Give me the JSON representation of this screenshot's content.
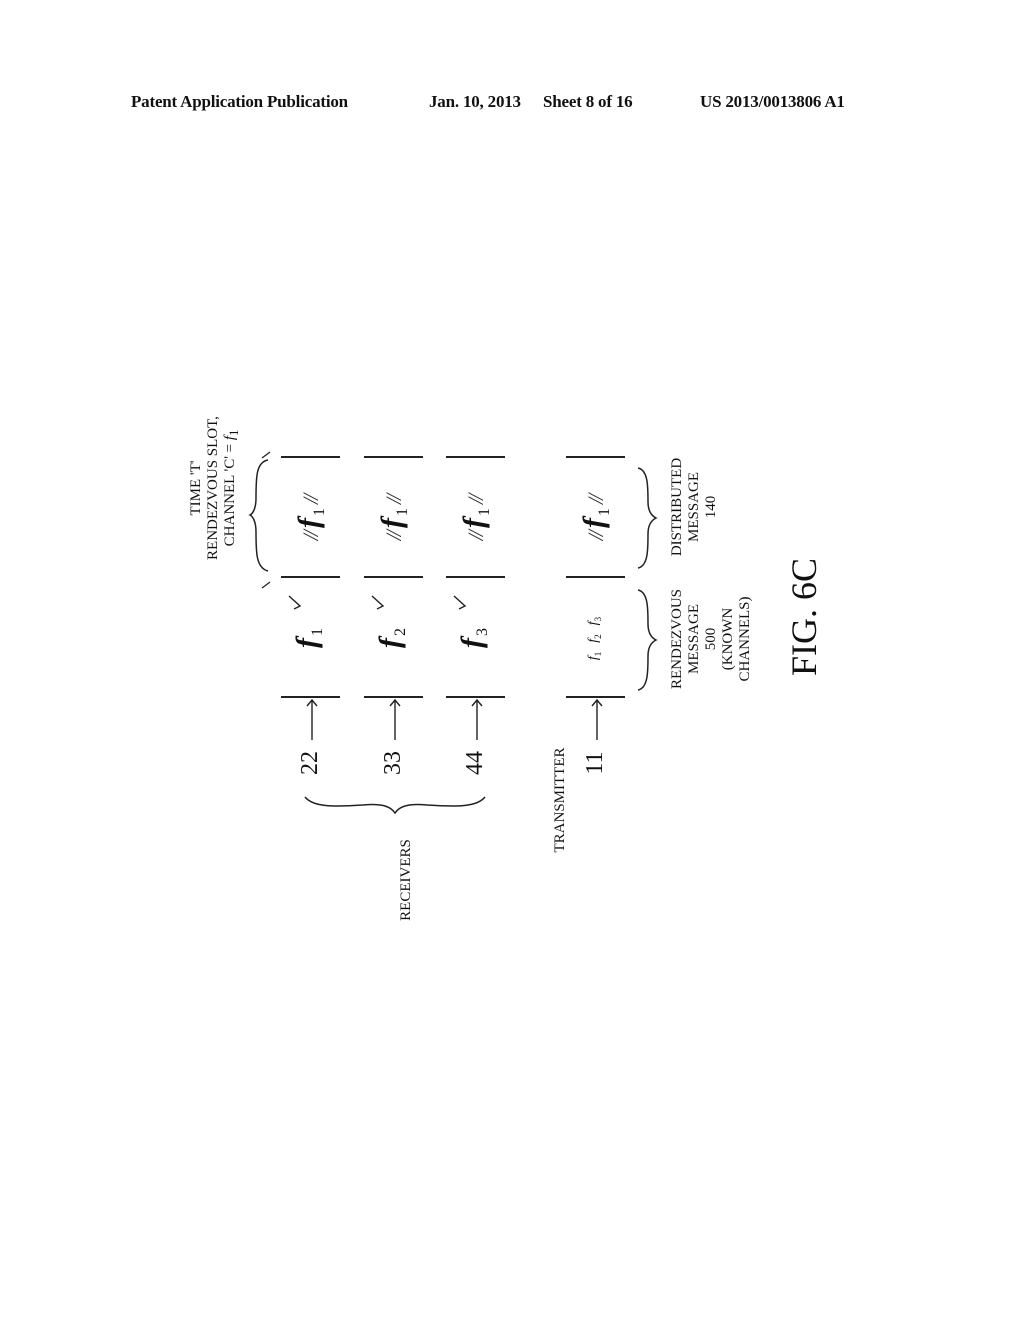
{
  "header": {
    "publication": "Patent Application Publication",
    "date": "Jan. 10, 2013",
    "sheet": "Sheet 8 of 16",
    "patent_number": "US 2013/0013806 A1"
  },
  "figure": {
    "caption": "FIG. 6C",
    "top_label": {
      "line1": "TIME 'T'",
      "line2": "RENDEZVOUS SLOT,",
      "line3_prefix": "CHANNEL 'C' = ",
      "line3_var": "f",
      "line3_sub": "1"
    },
    "group_labels": {
      "receivers": "RECEIVERS",
      "transmitter": "TRANSMITTER"
    },
    "rows": [
      {
        "id": "22",
        "rendezvous_var": "f",
        "rendezvous_sub": "1",
        "checked": true,
        "distributed": "f",
        "distributed_sub": "1"
      },
      {
        "id": "33",
        "rendezvous_var": "f",
        "rendezvous_sub": "2",
        "checked": true,
        "distributed": "f",
        "distributed_sub": "1"
      },
      {
        "id": "44",
        "rendezvous_var": "f",
        "rendezvous_sub": "3",
        "checked": true,
        "distributed": "f",
        "distributed_sub": "1"
      },
      {
        "id": "11",
        "rendezvous_list": [
          {
            "var": "f",
            "sub": "1"
          },
          {
            "var": "f",
            "sub": "2"
          },
          {
            "var": "f",
            "sub": "3"
          }
        ],
        "checked": false,
        "distributed": "f",
        "distributed_sub": "1"
      }
    ],
    "hatch": "//",
    "check_mark": "✓",
    "arrow": "⟶",
    "bottom_labels": {
      "rendezvous": {
        "line1": "RENDEZVOUS",
        "line2": "MESSAGE",
        "line3": "500",
        "line4": "(KNOWN",
        "line5": "CHANNELS)"
      },
      "distributed": {
        "line1": "DISTRIBUTED",
        "line2": "MESSAGE",
        "line3": "140"
      }
    }
  }
}
